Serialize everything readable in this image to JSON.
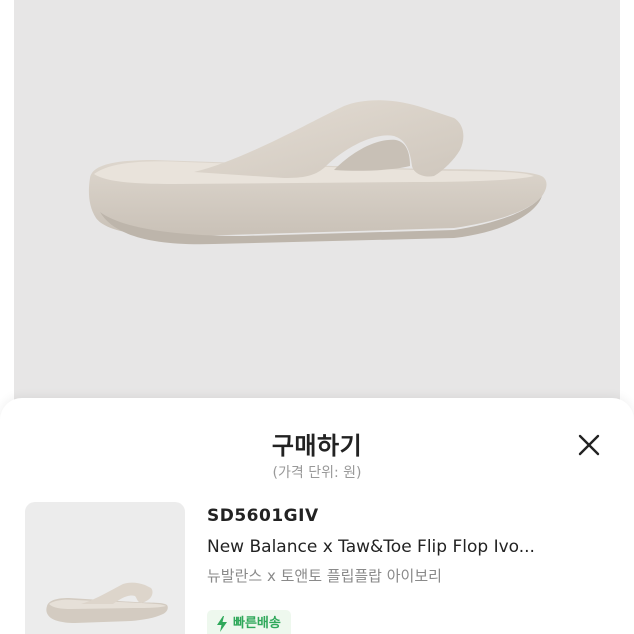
{
  "sheet": {
    "title": "구매하기",
    "subtitle": "(가격 단위: 원)",
    "close_icon": "close-icon"
  },
  "product": {
    "model_code": "SD5601GIV",
    "name": "New Balance x Taw&Toe Flip Flop Ivo...",
    "name_ko": "뉴발란스 x 토앤토 플립플랍 아이보리",
    "badge_label": "빠른배송",
    "badge_icon": "lightning-icon"
  },
  "colors": {
    "photo_background": "#e7e6e6",
    "badge_green": "#2fa85a",
    "badge_background": "#eef8ee",
    "sandal": "#d9d2c9"
  }
}
